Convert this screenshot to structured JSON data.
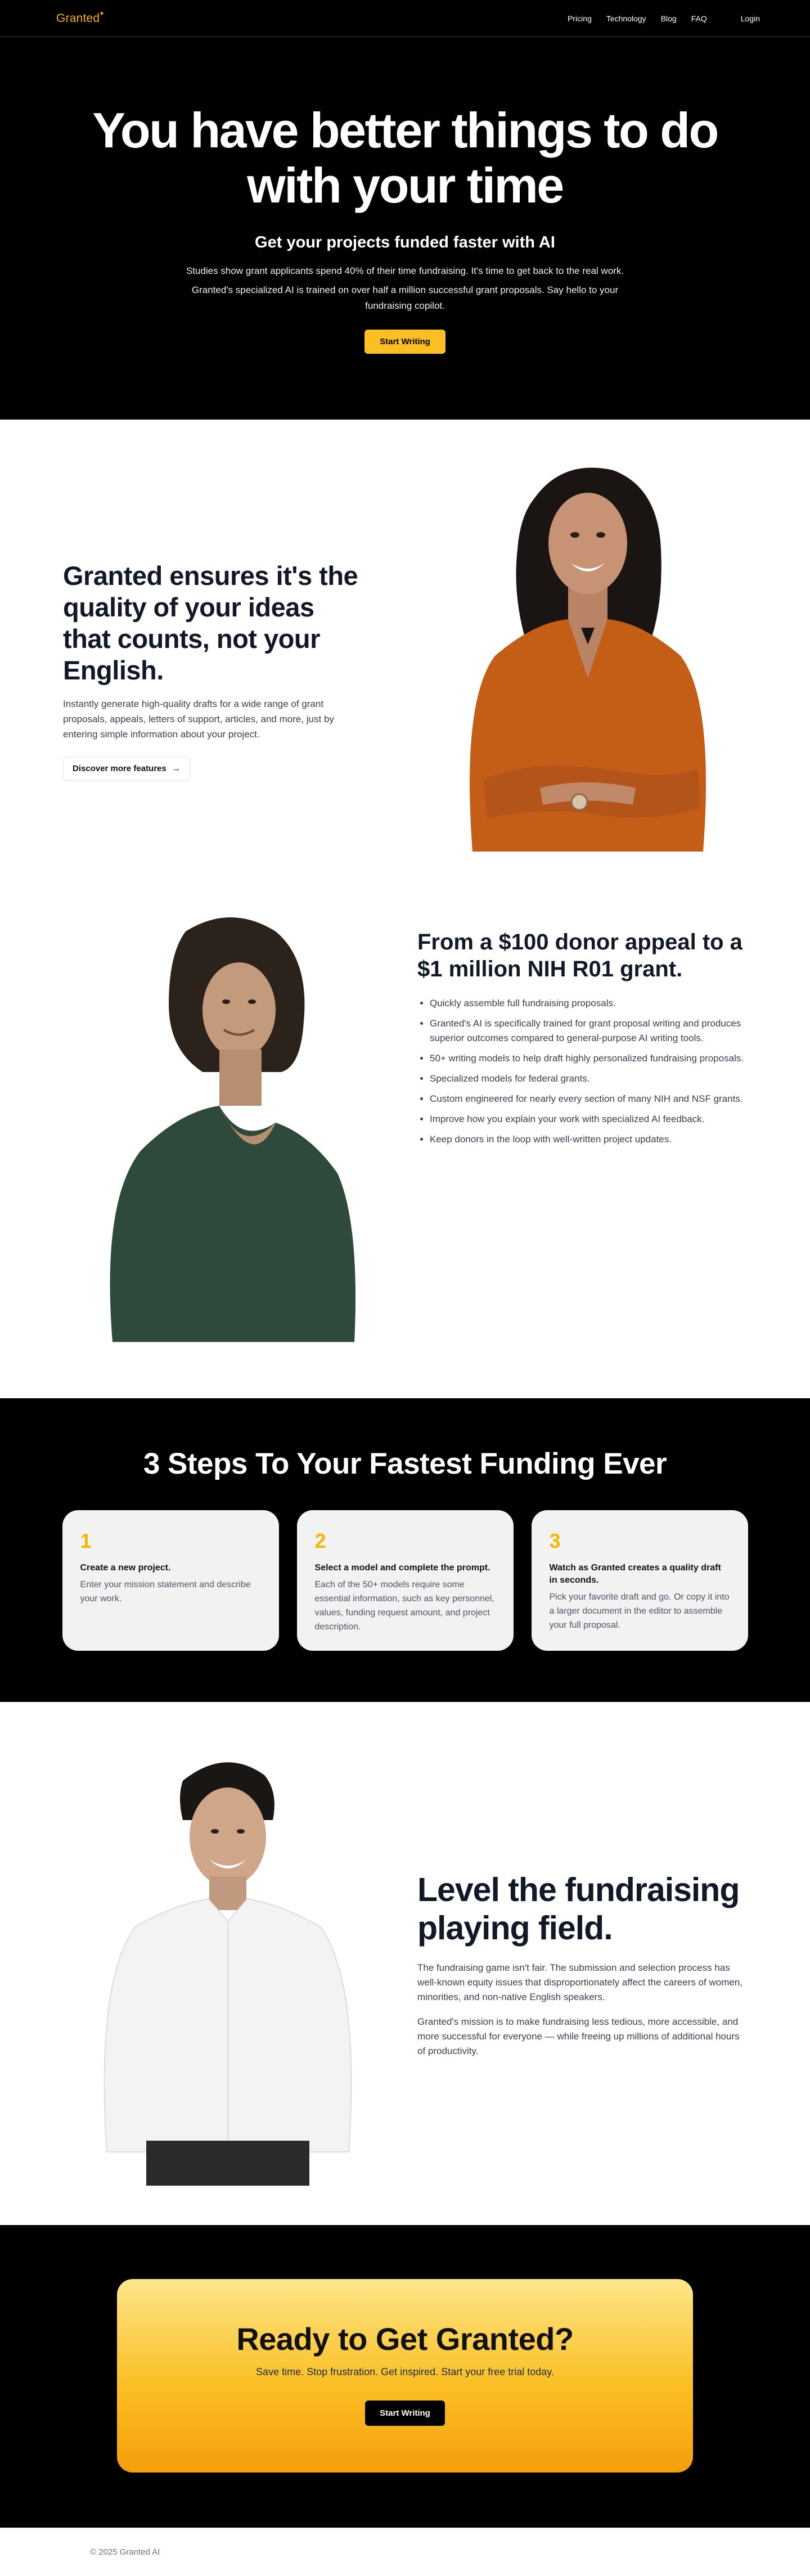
{
  "nav": {
    "logo": "Granted",
    "links": [
      "Pricing",
      "Technology",
      "Blog",
      "FAQ"
    ],
    "login": "Login"
  },
  "hero": {
    "title": "You have better things to do with your time",
    "subtitle": "Get your projects funded faster with AI",
    "paragraph1": "Studies show grant applicants spend 40% of their time fundraising. It's time to get back to the real work.",
    "paragraph2": "Granted's specialized AI is trained on over half a million successful grant proposals. Say hello to your fundraising copilot.",
    "cta": "Start Writing"
  },
  "section_quality": {
    "title": "Granted ensures it's the quality of your ideas that counts, not your English.",
    "body": "Instantly generate high-quality drafts for a wide range of grant proposals, appeals, letters of support, articles, and more, just by entering simple information about your project.",
    "button": "Discover more features"
  },
  "section_donor": {
    "title": "From a $100 donor appeal to a $1 million NIH R01 grant.",
    "bullets": [
      "Quickly assemble full fundraising proposals.",
      "Granted's AI is specifically trained for grant proposal writing and produces superior outcomes compared to general-purpose AI writing tools.",
      "50+ writing models to help draft highly personalized fundraising proposals.",
      "Specialized models for federal grants.",
      "Custom engineered for nearly every section of many NIH and NSF grants.",
      "Improve how you explain your work with specialized AI feedback.",
      "Keep donors in the loop with well-written project updates."
    ]
  },
  "steps": {
    "title": "3 Steps To Your Fastest Funding Ever",
    "items": [
      {
        "num": "1",
        "title": "Create a new project.",
        "desc": "Enter your mission statement and describe your work."
      },
      {
        "num": "2",
        "title": "Select a model and complete the prompt.",
        "desc": "Each of the 50+ models require some essential information, such as key personnel, values, funding request amount, and project description."
      },
      {
        "num": "3",
        "title": "Watch as Granted creates a quality draft in seconds.",
        "desc": "Pick your favorite draft and go. Or copy it into a larger document in the editor to assemble your full proposal."
      }
    ]
  },
  "section_level": {
    "title": "Level the fundraising playing field.",
    "paragraph1": "The fundraising game isn't fair. The submission and selection process has well-known equity issues that disproportionately affect the careers of women, minorities, and non-native English speakers.",
    "paragraph2": "Granted's mission is to make fundraising less tedious, more accessible, and more successful for everyone — while freeing up millions of additional hours of productivity."
  },
  "cta": {
    "title": "Ready to Get Granted?",
    "subtitle": "Save time. Stop frustration. Get inspired. Start your free trial today.",
    "button": "Start Writing"
  },
  "footer": {
    "copyright": "© 2025 Granted AI"
  },
  "colors": {
    "brand_yellow": "#fbbf24",
    "logo_gold": "#f5b000",
    "dark": "#000000"
  }
}
